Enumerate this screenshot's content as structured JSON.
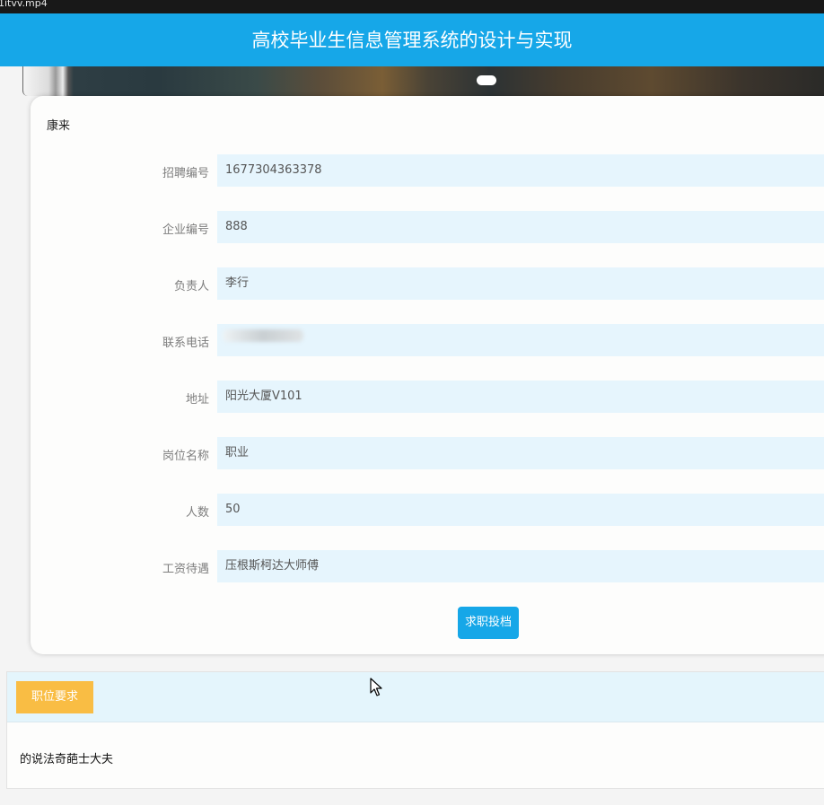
{
  "video_filename": "1itvv.mp4",
  "header": {
    "title": "高校毕业生信息管理系统的设计与实现"
  },
  "detail": {
    "name": "康来",
    "fields": [
      {
        "label": "招聘编号",
        "value": "1677304363378"
      },
      {
        "label": "企业编号",
        "value": "888"
      },
      {
        "label": "负责人",
        "value": "李行"
      },
      {
        "label": "联系电话",
        "value": ""
      },
      {
        "label": "地址",
        "value": "阳光大厦V101"
      },
      {
        "label": "岗位名称",
        "value": "职业"
      },
      {
        "label": "人数",
        "value": "50"
      },
      {
        "label": "工资待遇",
        "value": "压根斯柯达大师傅"
      }
    ],
    "submit_label": "求职投档"
  },
  "requirements": {
    "tab_label": "职位要求",
    "content": "的说法奇葩士大夫"
  }
}
